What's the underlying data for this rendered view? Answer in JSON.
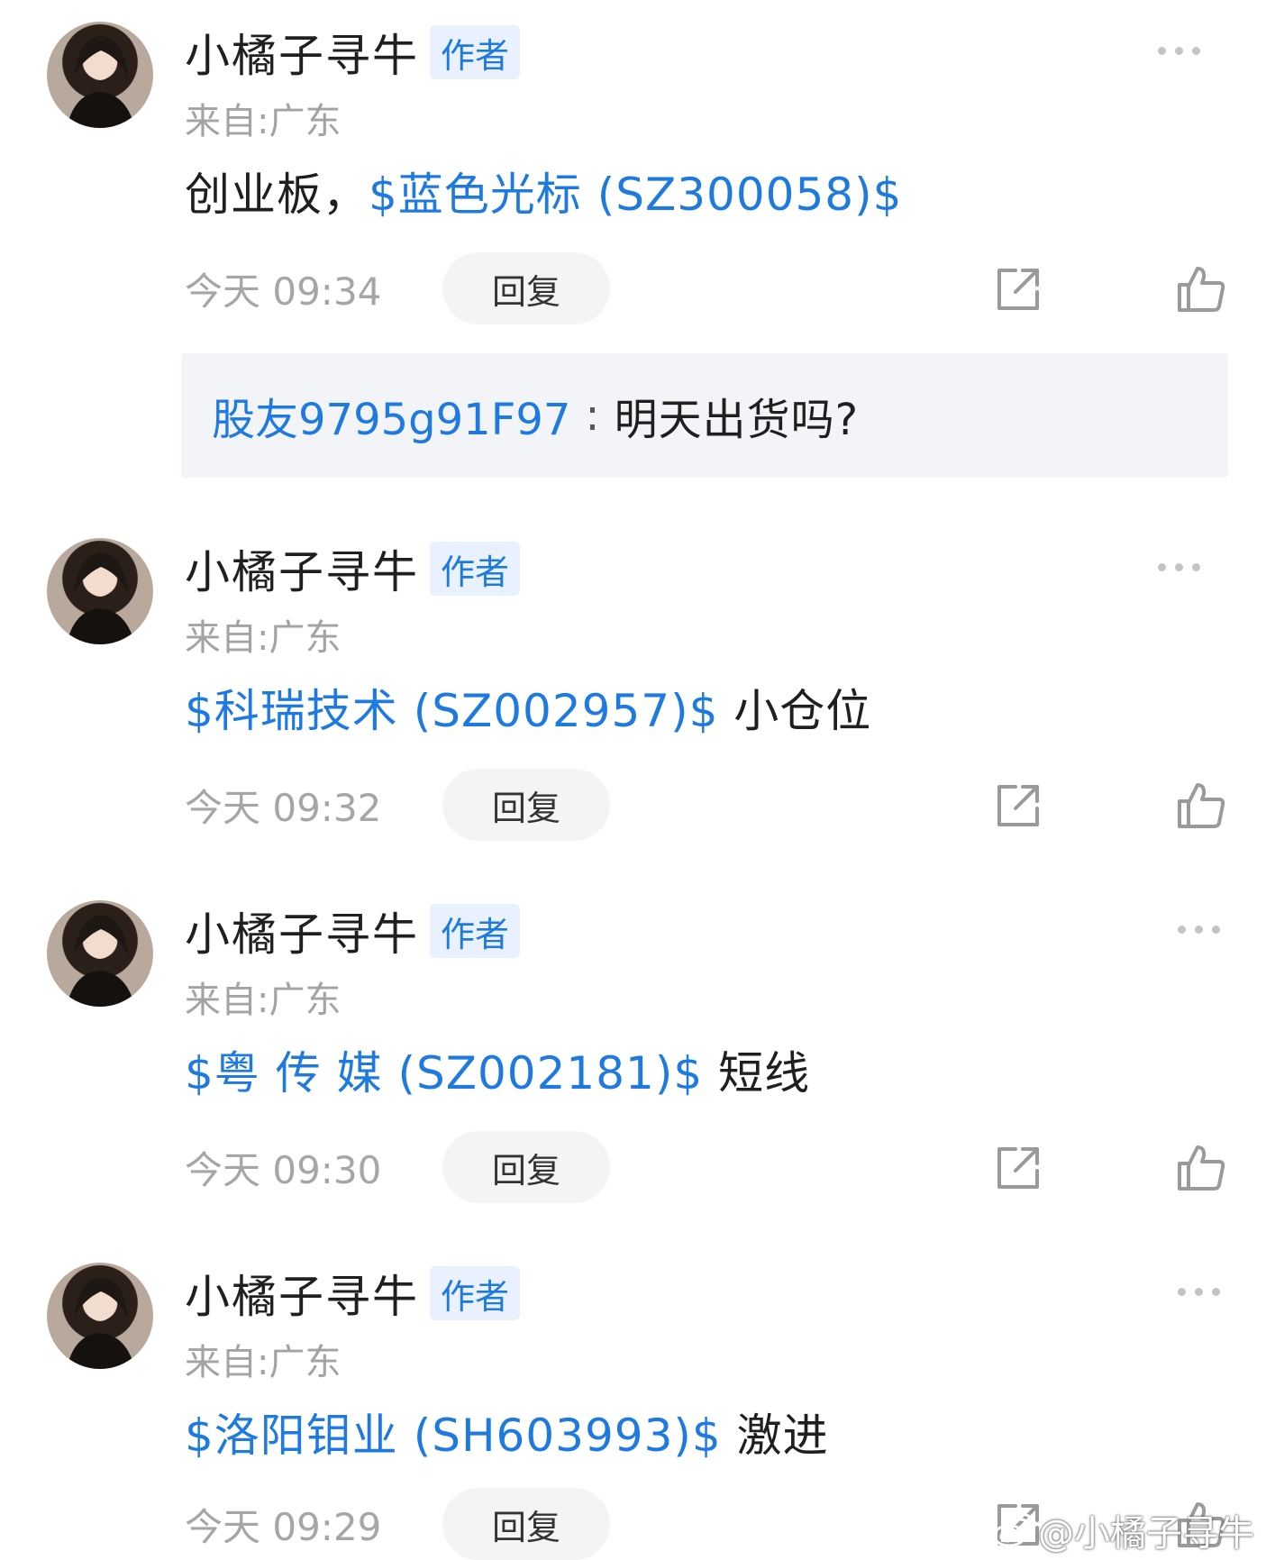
{
  "comments": [
    {
      "username": "小橘子寻牛",
      "badge": "作者",
      "location": "来自:广东",
      "text_prefix": "创业板，",
      "stock": "$蓝色光标 (SZ300058)$",
      "text_suffix": "",
      "time": "今天 09:34",
      "reply_label": "回复",
      "sub_reply": {
        "user": "股友9795g91F97",
        "separator": ":",
        "text": "明天出货吗?"
      }
    },
    {
      "username": "小橘子寻牛",
      "badge": "作者",
      "location": "来自:广东",
      "text_prefix": "",
      "stock": "$科瑞技术 (SZ002957)$",
      "text_suffix": " 小仓位",
      "time": "今天 09:32",
      "reply_label": "回复"
    },
    {
      "username": "小橘子寻牛",
      "badge": "作者",
      "location": "来自:广东",
      "text_prefix": "",
      "stock": "$粤 传 媒 (SZ002181)$",
      "text_suffix": " 短线",
      "time": "今天 09:30",
      "reply_label": "回复"
    },
    {
      "username": "小橘子寻牛",
      "badge": "作者",
      "location": "来自:广东",
      "text_prefix": "",
      "stock": "$洛阳钼业 (SH603993)$",
      "text_suffix": " 激进",
      "time": "今天 09:29",
      "reply_label": "回复"
    }
  ],
  "watermark": {
    "text": "@小橘子寻牛",
    "icon": "weibo-logo-icon"
  },
  "colors": {
    "link": "#1f7ae0",
    "muted": "#a6a6a6",
    "badge_bg": "#e8f1fd"
  }
}
